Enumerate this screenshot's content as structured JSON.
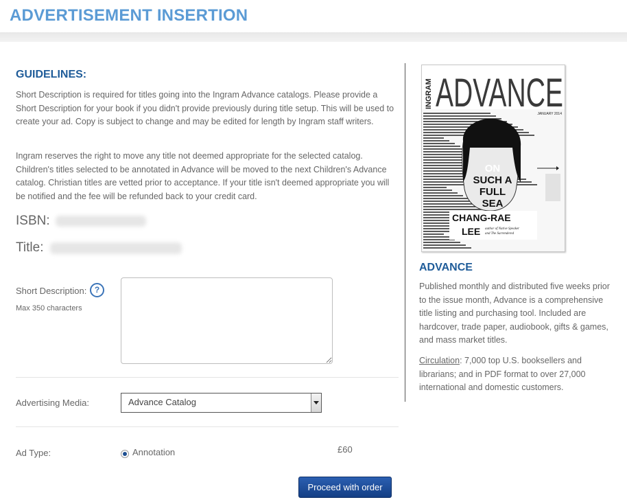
{
  "header": {
    "title": "ADVERTISEMENT INSERTION"
  },
  "guidelines": {
    "heading": "GUIDELINES:",
    "paragraph1": "Short Description is required for titles going into the Ingram Advance catalogs. Please provide a Short Description for your book if you didn't provide previously during title setup. This will be used to create your ad. Copy is subject to change and may be edited for length by Ingram staff writers.",
    "paragraph2": "Ingram reserves the right to move any title not deemed appropriate for the selected catalog. Children's titles selected to be annotated in Advance will be moved to the next Children's Advance catalog. Christian titles are vetted prior to acceptance. If your title isn't deemed appropriate you will be notified and the fee will be refunded back to your credit card."
  },
  "book": {
    "isbn_label": "ISBN:",
    "title_label": "Title:"
  },
  "form": {
    "short_description_label": "Short Description:",
    "max_chars_note": "Max 350 characters",
    "short_description_value": "",
    "advertising_media_label": "Advertising Media:",
    "advertising_media_selected": "Advance Catalog",
    "ad_type_label": "Ad Type:",
    "ad_type_option": "Annotation",
    "price": "£60",
    "proceed_label": "Proceed with order"
  },
  "sidebar": {
    "cover": {
      "brand": "ADVANCE",
      "side_brand": "INGRAM",
      "issue": "JANUARY 2014",
      "headline": [
        "ON",
        "SUCH A",
        "FULL",
        "SEA"
      ],
      "author": [
        "CHANG-RAE",
        "LEE"
      ],
      "author_note": [
        "author of Native Speaker",
        "and The Surrendered"
      ]
    },
    "heading": "ADVANCE",
    "description": "Published monthly and distributed five weeks prior to the issue month, Advance is a comprehensive title listing and purchasing tool. Included are hardcover, trade paper, audiobook, gifts & games, and mass market titles.",
    "circulation_label": "Circulation",
    "circulation_text": ": 7,000 top U.S. booksellers and librarians; and in PDF format to over 27,000 international and domestic customers."
  },
  "colors": {
    "title_blue": "#5b9bd5",
    "heading_blue": "#1f5c99",
    "button_blue": "#1d4f91"
  }
}
